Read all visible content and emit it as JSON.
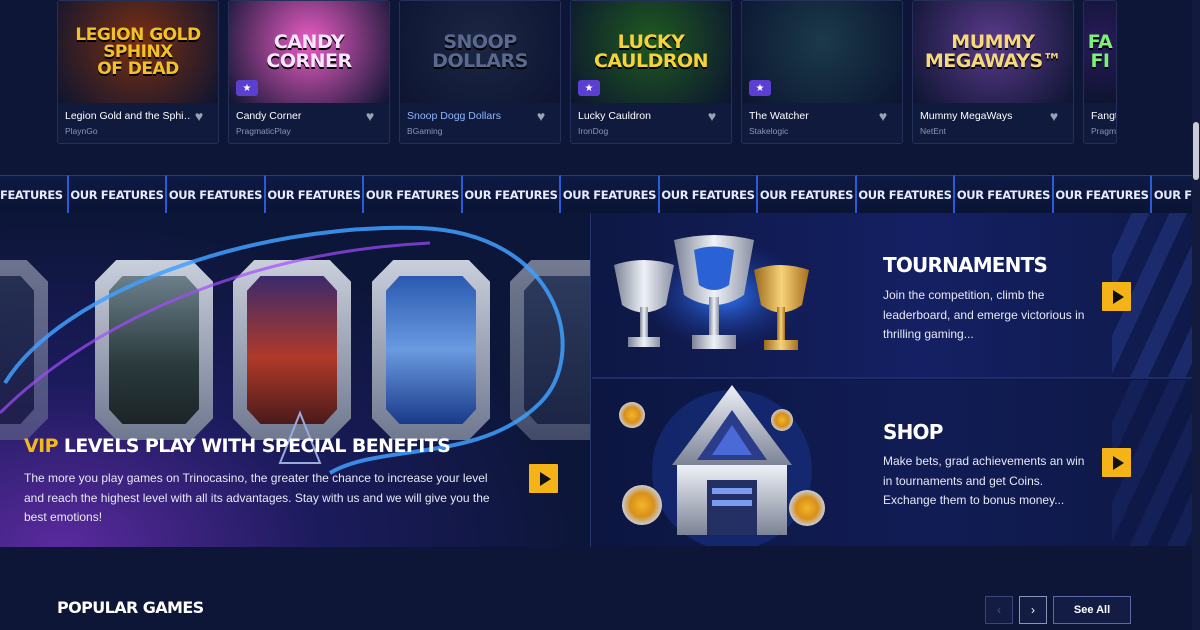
{
  "games": [
    {
      "title": "Legion Gold and the Sphi…",
      "provider": "PlaynGo",
      "art": "Legion Gold\nSphinx\nof Dead",
      "art_color": "#f3c027",
      "bg": "#7a2f12",
      "badge": false,
      "highlight": false
    },
    {
      "title": "Candy Corner",
      "provider": "PragmaticPlay",
      "art": "Candy\nCorner",
      "art_color": "#fbe6ff",
      "bg": "#ea5cc4",
      "badge": true,
      "highlight": false
    },
    {
      "title": "Snoop Dogg Dollars",
      "provider": "BGaming",
      "art": "Snoop\nDollars",
      "art_color": "#5a6a8f",
      "bg": "#1c2744",
      "badge": false,
      "highlight": true
    },
    {
      "title": "Lucky Cauldron",
      "provider": "IronDog",
      "art": "Lucky\nCauldron",
      "art_color": "#f6d33a",
      "bg": "#1f5a1f",
      "badge": true,
      "highlight": false
    },
    {
      "title": "The Watcher",
      "provider": "Stakelogic",
      "art": "",
      "art_color": "#9ab",
      "bg": "#1a3a4a",
      "badge": true,
      "highlight": false
    },
    {
      "title": "Mummy MegaWays",
      "provider": "NetEnt",
      "art": "Mummy\nMegaways™",
      "art_color": "#f6d97a",
      "bg": "#5a3a8a",
      "badge": false,
      "highlight": false
    },
    {
      "title": "Fangt",
      "provider": "Pragm",
      "art": "Fa\nFi",
      "art_color": "#7df07a",
      "bg": "#2a1a5a",
      "badge": false,
      "highlight": false
    }
  ],
  "marquee": {
    "items": [
      "OUR FEATURES",
      "OUR FEATURES",
      "OUR FEATURES",
      "OUR FEATURES",
      "OUR FEATURES",
      "OUR FEATURES",
      "OUR FEATURES",
      "OUR FEATURES",
      "OUR FEATURES",
      "OUR FEATURES",
      "OUR FEATURES",
      "OUR FEATURES",
      "OUR"
    ],
    "first_fragment": "FEATURES"
  },
  "vip": {
    "title_accent": "VIP",
    "title_rest": "LEVELS PLAY WITH SPECIAL BENEFITS",
    "description": "The more you play games on Trinocasino, the greater the chance to increase your level and reach the highest level with all its advantages. Stay with us and we will give you the best emotions!"
  },
  "tournaments": {
    "title": "TOURNAMENTS",
    "description": "Join the competition, climb the leaderboard, and emerge victorious in thrilling gaming..."
  },
  "shop": {
    "title": "SHOP",
    "description": "Make bets, grad achievements an win in tournaments and get Coins. Exchange them to bonus money..."
  },
  "popular": {
    "title": "POPULAR GAMES",
    "see_all": "See All",
    "prev_icon": "‹",
    "next_icon": "›"
  },
  "colors": {
    "accent": "#f4b418",
    "background": "#0d1636",
    "marquee_border": "#2b5bd6"
  }
}
